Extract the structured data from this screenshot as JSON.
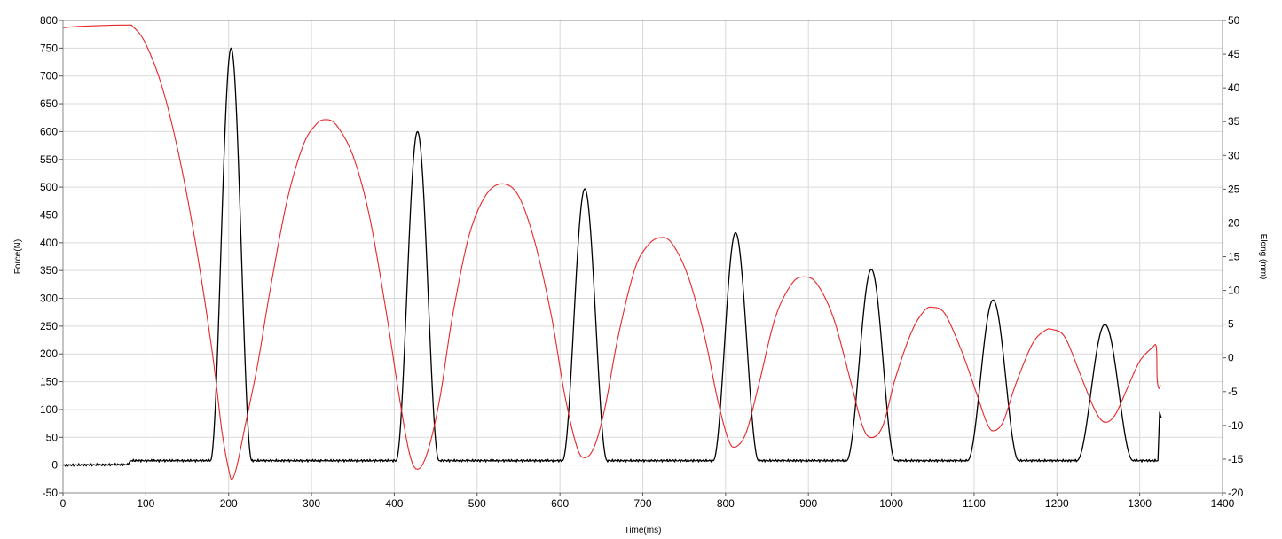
{
  "chart_data": {
    "type": "line",
    "title": "",
    "xlabel": "Time(ms)",
    "ylabel": "Force(N)",
    "y2label": "Elong (mm)",
    "xlim": [
      0,
      1400
    ],
    "ylim": [
      -50,
      800
    ],
    "y2lim": [
      -20,
      50
    ],
    "grid": true,
    "legend": "none",
    "x_ticks": [
      0,
      100,
      200,
      300,
      400,
      500,
      600,
      700,
      800,
      900,
      1000,
      1100,
      1200,
      1300,
      1400
    ],
    "y_ticks": [
      -50,
      0,
      50,
      100,
      150,
      200,
      250,
      300,
      350,
      400,
      450,
      500,
      550,
      600,
      650,
      700,
      750,
      800
    ],
    "y2_ticks": [
      -20,
      -15,
      -10,
      -5,
      0,
      5,
      10,
      15,
      20,
      25,
      30,
      35,
      40,
      45,
      50
    ],
    "series": [
      {
        "axis": "left",
        "color": "#000000",
        "peaks": [
          {
            "start": 178,
            "peak_x": 203,
            "peak_y": 750,
            "end": 228
          },
          {
            "start": 402,
            "peak_x": 428,
            "peak_y": 600,
            "end": 454
          },
          {
            "start": 603,
            "peak_x": 630,
            "peak_y": 497,
            "end": 657
          },
          {
            "start": 785,
            "peak_x": 812,
            "peak_y": 418,
            "end": 840
          },
          {
            "start": 946,
            "peak_x": 976,
            "peak_y": 352,
            "end": 1005
          },
          {
            "start": 1092,
            "peak_x": 1123,
            "peak_y": 297,
            "end": 1154
          },
          {
            "start": 1224,
            "peak_x": 1258,
            "peak_y": 253,
            "end": 1292
          }
        ],
        "baseline": [
          {
            "x": 0,
            "y": 0
          },
          {
            "x": 78,
            "y": 1
          },
          {
            "x": 82,
            "y": 8
          },
          {
            "x": 1300,
            "y": 8
          }
        ],
        "tail": [
          {
            "x": 1322,
            "y": 8
          },
          {
            "x": 1324,
            "y": 95
          },
          {
            "x": 1326,
            "y": 85
          }
        ]
      },
      {
        "axis": "right",
        "color": "#e8262a",
        "points": [
          {
            "x": 0,
            "y": 48.9
          },
          {
            "x": 20,
            "y": 49.1
          },
          {
            "x": 75,
            "y": 49.3
          },
          {
            "x": 85,
            "y": 49.0
          },
          {
            "x": 100,
            "y": 46.5
          },
          {
            "x": 120,
            "y": 40
          },
          {
            "x": 140,
            "y": 30
          },
          {
            "x": 160,
            "y": 17
          },
          {
            "x": 180,
            "y": 1
          },
          {
            "x": 192,
            "y": -11
          },
          {
            "x": 200,
            "y": -16.5
          },
          {
            "x": 204,
            "y": -18.0
          },
          {
            "x": 210,
            "y": -16
          },
          {
            "x": 220,
            "y": -10
          },
          {
            "x": 235,
            "y": -1
          },
          {
            "x": 250,
            "y": 10
          },
          {
            "x": 270,
            "y": 23
          },
          {
            "x": 290,
            "y": 31.5
          },
          {
            "x": 305,
            "y": 34.5
          },
          {
            "x": 316,
            "y": 35.3
          },
          {
            "x": 330,
            "y": 34.5
          },
          {
            "x": 350,
            "y": 30
          },
          {
            "x": 370,
            "y": 21
          },
          {
            "x": 390,
            "y": 7
          },
          {
            "x": 405,
            "y": -5
          },
          {
            "x": 418,
            "y": -14
          },
          {
            "x": 428,
            "y": -16.5
          },
          {
            "x": 440,
            "y": -14
          },
          {
            "x": 455,
            "y": -6
          },
          {
            "x": 470,
            "y": 6
          },
          {
            "x": 490,
            "y": 18
          },
          {
            "x": 510,
            "y": 24
          },
          {
            "x": 530,
            "y": 25.8
          },
          {
            "x": 550,
            "y": 24
          },
          {
            "x": 570,
            "y": 17
          },
          {
            "x": 590,
            "y": 6
          },
          {
            "x": 605,
            "y": -5
          },
          {
            "x": 620,
            "y": -13
          },
          {
            "x": 630,
            "y": -14.8
          },
          {
            "x": 642,
            "y": -13
          },
          {
            "x": 655,
            "y": -7
          },
          {
            "x": 670,
            "y": 3
          },
          {
            "x": 690,
            "y": 13
          },
          {
            "x": 705,
            "y": 16.5
          },
          {
            "x": 720,
            "y": 17.8
          },
          {
            "x": 735,
            "y": 17
          },
          {
            "x": 755,
            "y": 12
          },
          {
            "x": 775,
            "y": 3
          },
          {
            "x": 790,
            "y": -6
          },
          {
            "x": 803,
            "y": -12
          },
          {
            "x": 812,
            "y": -13.2
          },
          {
            "x": 825,
            "y": -11
          },
          {
            "x": 840,
            "y": -4
          },
          {
            "x": 860,
            "y": 6
          },
          {
            "x": 880,
            "y": 11
          },
          {
            "x": 895,
            "y": 12
          },
          {
            "x": 910,
            "y": 11
          },
          {
            "x": 930,
            "y": 6
          },
          {
            "x": 950,
            "y": -3
          },
          {
            "x": 965,
            "y": -10
          },
          {
            "x": 976,
            "y": -11.8
          },
          {
            "x": 990,
            "y": -10
          },
          {
            "x": 1005,
            "y": -3
          },
          {
            "x": 1025,
            "y": 4
          },
          {
            "x": 1040,
            "y": 7
          },
          {
            "x": 1050,
            "y": 7.5
          },
          {
            "x": 1065,
            "y": 6.5
          },
          {
            "x": 1085,
            "y": 1
          },
          {
            "x": 1105,
            "y": -6
          },
          {
            "x": 1115,
            "y": -9.5
          },
          {
            "x": 1123,
            "y": -10.8
          },
          {
            "x": 1135,
            "y": -9.5
          },
          {
            "x": 1150,
            "y": -4
          },
          {
            "x": 1170,
            "y": 2
          },
          {
            "x": 1185,
            "y": 4
          },
          {
            "x": 1195,
            "y": 4.2
          },
          {
            "x": 1210,
            "y": 3
          },
          {
            "x": 1230,
            "y": -3
          },
          {
            "x": 1245,
            "y": -7.5
          },
          {
            "x": 1257,
            "y": -9.5
          },
          {
            "x": 1270,
            "y": -8.5
          },
          {
            "x": 1285,
            "y": -4.5
          },
          {
            "x": 1300,
            "y": -0.5
          },
          {
            "x": 1315,
            "y": 1.5
          },
          {
            "x": 1320,
            "y": 1.6
          },
          {
            "x": 1321,
            "y": -3
          },
          {
            "x": 1323,
            "y": -4.5
          },
          {
            "x": 1325,
            "y": -4
          }
        ]
      }
    ]
  }
}
